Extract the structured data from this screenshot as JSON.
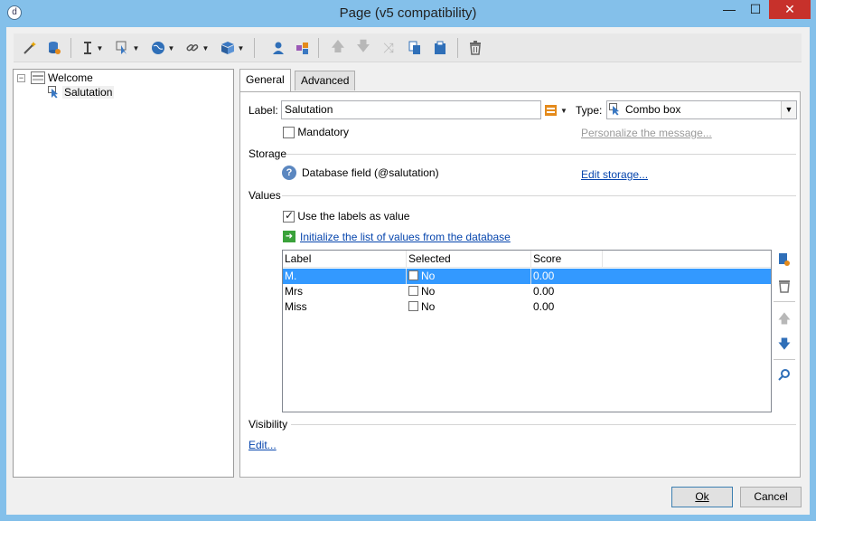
{
  "window": {
    "title": "Page (v5 compatibility)",
    "minimize_glyph": "—",
    "maximize_glyph": "☐",
    "close_glyph": "✕",
    "app_icon_glyph": "d"
  },
  "toolbar": {
    "icons": [
      "magic-wand-icon",
      "database-icon",
      "insert-field-icon",
      "input-control-icon",
      "globe-icon",
      "link-icon",
      "package-icon",
      "person-icon",
      "add-person-icon",
      "move-up-icon",
      "move-down-icon",
      "shuffle-icon",
      "copy-icon",
      "paste-icon",
      "delete-icon"
    ]
  },
  "tree": {
    "root_label": "Welcome",
    "expander_glyph": "−",
    "child_label": "Salutation"
  },
  "tabs": {
    "general": "General",
    "advanced": "Advanced"
  },
  "form": {
    "label_caption": "Label:",
    "label_value": "Salutation",
    "type_caption": "Type:",
    "type_value": "Combo box",
    "mandatory_label": "Mandatory",
    "personalize_link": "Personalize the message...",
    "storage_title": "Storage",
    "storage_text": "Database field (@salutation)",
    "edit_storage_link": "Edit storage...",
    "values_title": "Values",
    "use_labels_label": "Use the labels as value",
    "init_list_link": "Initialize the list of values from the database",
    "visibility_title": "Visibility",
    "edit_link": "Edit..."
  },
  "grid": {
    "columns": [
      "Label",
      "Selected",
      "Score"
    ],
    "rows": [
      {
        "label": "M.",
        "selected": "No",
        "score": "0.00"
      },
      {
        "label": "Mrs",
        "selected": "No",
        "score": "0.00"
      },
      {
        "label": "Miss",
        "selected": "No",
        "score": "0.00"
      }
    ],
    "selected_row": 0
  },
  "buttons": {
    "ok": "Ok",
    "cancel": "Cancel"
  },
  "colors": {
    "window_frame": "#84c0ea",
    "selection": "#3399ff",
    "link": "#0645ad",
    "close_button": "#c7312b"
  }
}
